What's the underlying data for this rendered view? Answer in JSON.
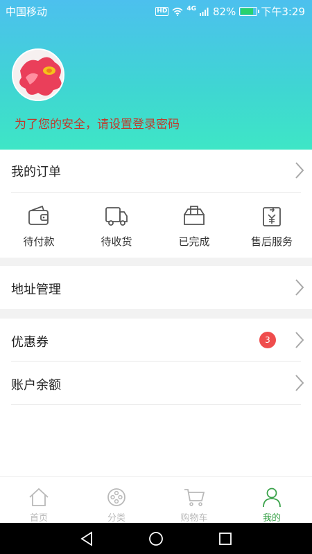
{
  "status_bar": {
    "carrier": "中国移动",
    "hd": "HD",
    "network": "4G",
    "battery": "82%",
    "time": "下午3:29"
  },
  "profile": {
    "notice": "为了您的安全，请设置登录密码"
  },
  "orders_row": {
    "label": "我的订单"
  },
  "order_status": [
    {
      "label": "待付款",
      "icon": "wallet-icon"
    },
    {
      "label": "待收货",
      "icon": "truck-icon"
    },
    {
      "label": "已完成",
      "icon": "box-icon"
    },
    {
      "label": "售后服务",
      "icon": "refund-icon"
    }
  ],
  "address_row": {
    "label": "地址管理"
  },
  "coupon_row": {
    "label": "优惠券",
    "badge": "3"
  },
  "balance_row": {
    "label": "账户余额"
  },
  "tabbar": [
    {
      "label": "首页",
      "icon": "home-icon"
    },
    {
      "label": "分类",
      "icon": "category-icon"
    },
    {
      "label": "购物车",
      "icon": "cart-icon"
    },
    {
      "label": "我的",
      "icon": "user-icon",
      "active": true
    }
  ],
  "colors": {
    "accent_green": "#3aa24a",
    "notice_red": "#c0392b",
    "badge_red": "#ef4d4d",
    "header_top": "#4cc0ee",
    "header_bottom": "#3ee6c6"
  }
}
